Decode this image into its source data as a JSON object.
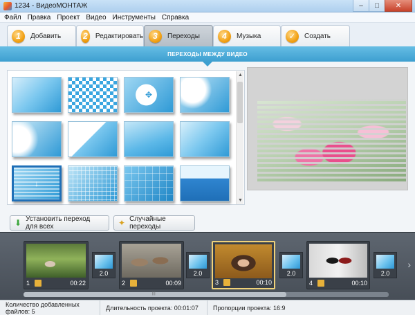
{
  "window": {
    "title": "1234 - ВидеоМОНТАЖ",
    "controls": {
      "minimize": "–",
      "maximize": "□",
      "close": "✕"
    }
  },
  "menu": [
    "Файл",
    "Правка",
    "Проект",
    "Видео",
    "Инструменты",
    "Справка"
  ],
  "tabs": [
    {
      "num": "1",
      "label": "Добавить",
      "active": false
    },
    {
      "num": "2",
      "label": "Редактировать",
      "active": false
    },
    {
      "num": "3",
      "label": "Переходы",
      "active": true
    },
    {
      "num": "4",
      "label": "Музыка",
      "active": false
    },
    {
      "num": "✓",
      "label": "Создать",
      "active": false
    }
  ],
  "section": {
    "title": "ПЕРЕХОДЫ МЕЖДУ ВИДЕО"
  },
  "transitions": [
    {
      "style": "waves"
    },
    {
      "style": "checker"
    },
    {
      "style": "circle"
    },
    {
      "style": "spot"
    },
    {
      "style": "corner"
    },
    {
      "style": "diagonal"
    },
    {
      "style": "soft"
    },
    {
      "style": "plain"
    },
    {
      "style": "stripes",
      "selected": true
    },
    {
      "style": "grid"
    },
    {
      "style": "squares"
    },
    {
      "style": "slide"
    }
  ],
  "scroll": {
    "up": "▲",
    "down": "▼"
  },
  "buttons": {
    "apply_all": "Установить переход для всех",
    "random": "Случайные переходы"
  },
  "clips": [
    {
      "num": "1",
      "duration": "00:22",
      "selected": false
    },
    {
      "num": "2",
      "duration": "00:09",
      "selected": false
    },
    {
      "num": "3",
      "duration": "00:10",
      "selected": true
    },
    {
      "num": "4",
      "duration": "00:10",
      "selected": false
    }
  ],
  "transition_durations": [
    "2.0",
    "2.0",
    "2.0",
    "2.0"
  ],
  "timeline": {
    "grip": "|||",
    "next_arrow": "›"
  },
  "status": {
    "files": "Количество добавленных файлов: 5",
    "duration": "Длительность проекта: 00:01:07",
    "ratio": "Пропорции проекта: 16:9"
  },
  "colors": {
    "accent": "#3d9fd0",
    "tab_badge": "#f2a115",
    "selected_clip": "#f0d27a"
  }
}
